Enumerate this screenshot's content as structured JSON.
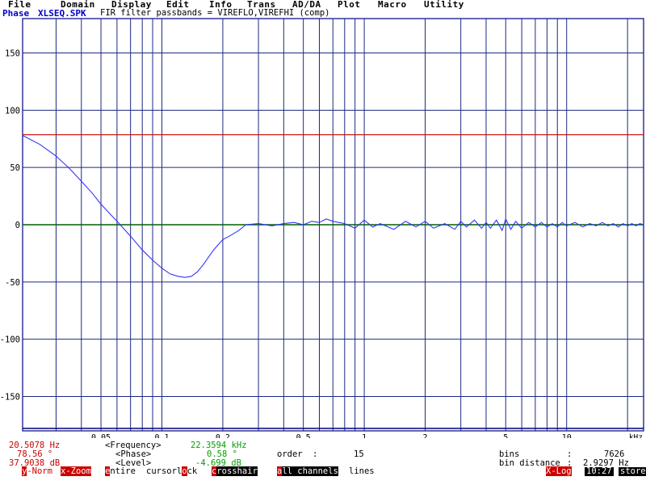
{
  "menu": [
    "File",
    "Domain",
    "Display",
    "Edit",
    "Info",
    "Trans",
    "AD/DA",
    "Plot",
    "Macro",
    "Utility"
  ],
  "title": {
    "mode": "Phase",
    "file": "XLSEQ.SPK",
    "description": "FIR filter passbands = VIREFLO,VIREFHI (comp)"
  },
  "chart_data": {
    "type": "line",
    "y_ticks": [
      "150",
      "100",
      "50",
      "0",
      "-50",
      "-100",
      "-150"
    ],
    "ylim": [
      -180,
      180
    ],
    "x_scale": "log",
    "xlim_khz": [
      0.0205,
      24
    ],
    "x_tick_labels": [
      "0.05",
      "0.1",
      "0.2",
      "0.5",
      "1",
      "2",
      "5",
      "10"
    ],
    "x_unit": "kHz",
    "grid": true,
    "cursor_line_y": 78.56,
    "series": [
      {
        "color": "#3333ff",
        "x": [
          0.0205,
          0.025,
          0.03,
          0.035,
          0.04,
          0.045,
          0.05,
          0.055,
          0.06,
          0.07,
          0.08,
          0.09,
          0.1,
          0.11,
          0.12,
          0.13,
          0.14,
          0.15,
          0.16,
          0.18,
          0.2,
          0.22,
          0.24,
          0.26,
          0.3,
          0.35,
          0.4,
          0.45,
          0.5,
          0.55,
          0.6,
          0.65,
          0.7,
          0.8,
          0.9,
          1.0,
          1.1,
          1.2,
          1.4,
          1.6,
          1.8,
          2.0,
          2.2,
          2.5,
          2.8,
          3.0,
          3.2,
          3.5,
          3.8,
          4.0,
          4.2,
          4.5,
          4.8,
          5.0,
          5.3,
          5.6,
          6.0,
          6.5,
          7.0,
          7.5,
          8.0,
          8.5,
          9.0,
          9.5,
          10,
          11,
          12,
          13,
          14,
          15,
          16,
          17,
          18,
          19,
          20,
          21,
          22,
          23,
          24
        ],
        "y": [
          78,
          70,
          60,
          49,
          38,
          28,
          18,
          10,
          3,
          -10,
          -22,
          -31,
          -38,
          -43,
          -45,
          -46,
          -45,
          -41,
          -35,
          -22,
          -13,
          -9,
          -5,
          0,
          1,
          -1,
          1,
          2,
          0,
          3,
          2,
          5,
          3,
          1,
          -3,
          4,
          -2,
          1,
          -4,
          3,
          -2,
          3,
          -3,
          1,
          -4,
          3,
          -2,
          4,
          -3,
          2,
          -3,
          4,
          -5,
          5,
          -4,
          3,
          -3,
          2,
          -2,
          2,
          -2,
          1,
          -2,
          2,
          -1,
          2,
          -2,
          1,
          -1,
          2,
          -1,
          1,
          -2,
          1,
          -1,
          1,
          -1,
          1,
          0
        ]
      }
    ]
  },
  "status": {
    "freq_left": "20.5078 Hz",
    "phase_left": "78.56 °",
    "level_left": "37.9038 dB",
    "freq_label": "<Frequency>",
    "phase_label": "<Phase>",
    "level_label": "<Level>",
    "freq_right": "22.3594 kHz",
    "phase_right": "0.58 °",
    "level_right": "-4.699 dB",
    "order_label": "order",
    "order_colon": ":",
    "order_value": "15",
    "bins_label": "bins",
    "bins_colon": ":",
    "bins_value": "7626",
    "bin_distance_label": "bin distance",
    "bin_distance_colon": ":",
    "bin_distance_value": "2.9297 Hz"
  },
  "buttons": {
    "ynorm_hot": "y",
    "ynorm_rest": "-Norm",
    "xzoom_hot": "x",
    "xzoom_rest": "-Zoom",
    "entire_hot": "e",
    "entire_rest": "ntire",
    "cursorlock_pre": "cursorl",
    "cursorlock_hot": "o",
    "cursorlock_rest": "ck",
    "crosshair_hot": "c",
    "crosshair_rest": "rosshair",
    "allch_hot": "a",
    "allch_rest": "ll channels",
    "lines": "lines",
    "xlog_hot": "X",
    "xlog_rest": "-Log",
    "clock": "10:27",
    "store": "store"
  }
}
